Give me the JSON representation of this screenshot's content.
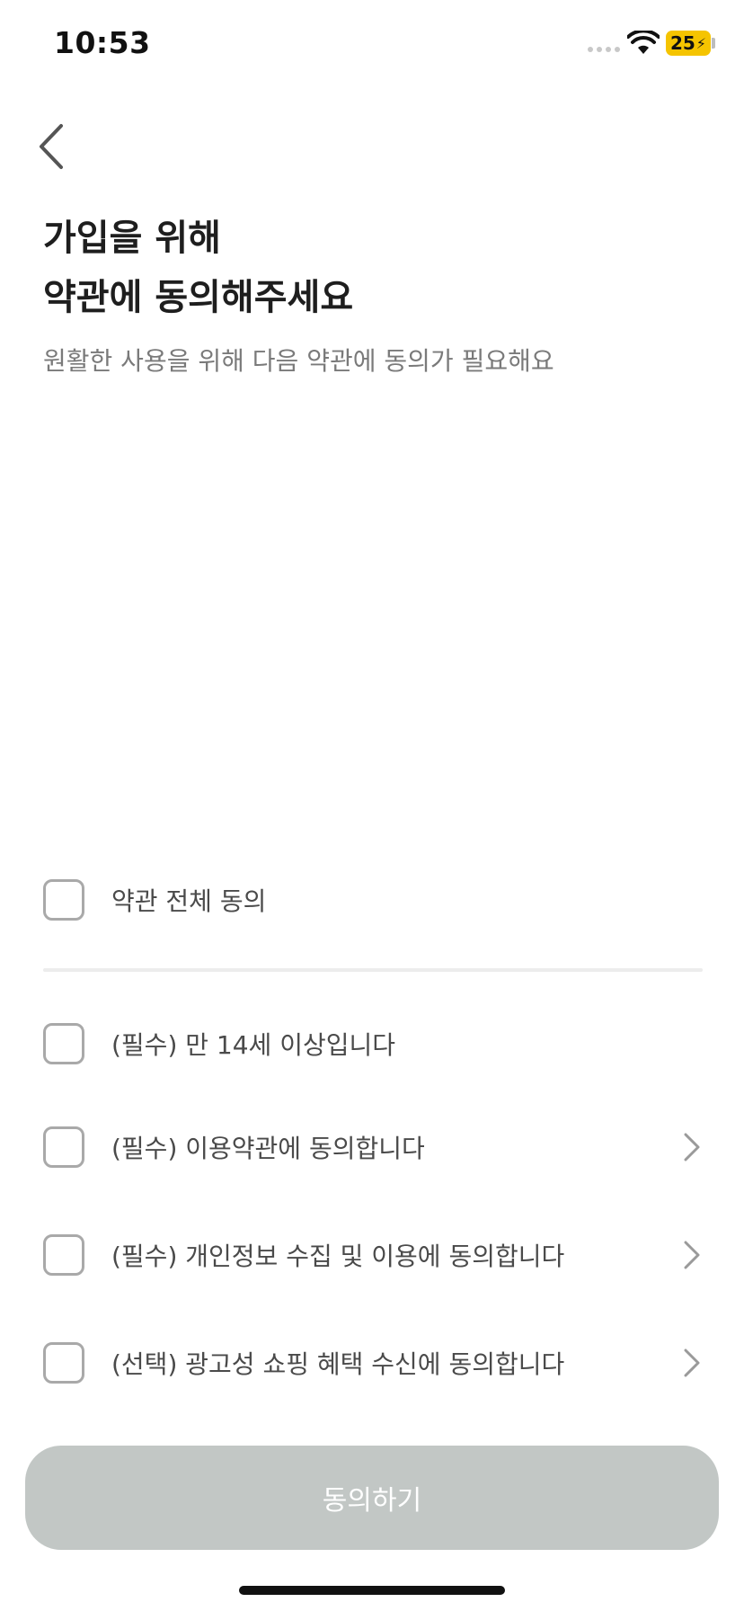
{
  "status_bar": {
    "time": "10:53",
    "battery_level": "25",
    "battery_color": "#f5c400"
  },
  "nav": {
    "back_icon": "chevron-left-icon"
  },
  "header": {
    "title_line1": "가입을 위해",
    "title_line2": "약관에 동의해주세요",
    "subtitle": "원활한 사용을 위해 다음 약관에 동의가 필요해요"
  },
  "agree_all": {
    "label": "약관 전체 동의",
    "checked": false
  },
  "terms": [
    {
      "label": "(필수) 만 14세 이상입니다",
      "checked": false,
      "has_detail": false
    },
    {
      "label": "(필수) 이용약관에 동의합니다",
      "checked": false,
      "has_detail": true
    },
    {
      "label": "(필수) 개인정보 수집 및 이용에 동의합니다",
      "checked": false,
      "has_detail": true
    },
    {
      "label": "(선택) 광고성 쇼핑 혜택 수신에 동의합니다",
      "checked": false,
      "has_detail": true
    }
  ],
  "footer": {
    "submit_label": "동의하기",
    "submit_enabled": false,
    "submit_color": "#c2c7c5"
  }
}
